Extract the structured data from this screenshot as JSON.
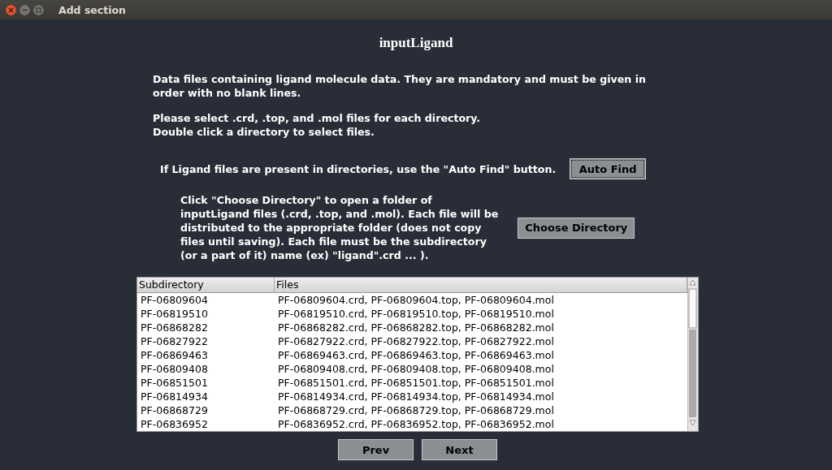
{
  "window": {
    "title": "Add section"
  },
  "heading": "inputLigand",
  "intro": [
    "Data files containing ligand molecule data. They are mandatory and must be given in\norder with no blank lines.",
    "Please select .crd, .top, and .mol files for each directory.\nDouble click a directory to select files."
  ],
  "auto_find": {
    "text": "If Ligand files are present in directories, use the \"Auto Find\" button.",
    "button": "Auto Find"
  },
  "choose_directory": {
    "text": "Click \"Choose Directory\" to open a folder of\ninputLigand files (.crd, .top, and .mol). Each file will be\ndistributed to the appropriate folder (does not copy\nfiles until saving). Each file must be the subdirectory\n(or a part of it) name (ex) \"ligand\".crd ... ).",
    "button": "Choose Directory"
  },
  "table": {
    "columns": [
      "Subdirectory",
      "Files"
    ],
    "rows": [
      [
        "PF-06809604",
        "PF-06809604.crd, PF-06809604.top, PF-06809604.mol"
      ],
      [
        "PF-06819510",
        "PF-06819510.crd, PF-06819510.top, PF-06819510.mol"
      ],
      [
        "PF-06868282",
        "PF-06868282.crd, PF-06868282.top, PF-06868282.mol"
      ],
      [
        "PF-06827922",
        "PF-06827922.crd, PF-06827922.top, PF-06827922.mol"
      ],
      [
        "PF-06869463",
        "PF-06869463.crd, PF-06869463.top, PF-06869463.mol"
      ],
      [
        "PF-06809408",
        "PF-06809408.crd, PF-06809408.top, PF-06809408.mol"
      ],
      [
        "PF-06851501",
        "PF-06851501.crd, PF-06851501.top, PF-06851501.mol"
      ],
      [
        "PF-06814934",
        "PF-06814934.crd, PF-06814934.top, PF-06814934.mol"
      ],
      [
        "PF-06868729",
        "PF-06868729.crd, PF-06868729.top, PF-06868729.mol"
      ],
      [
        "PF-06836952",
        "PF-06836952.crd, PF-06836952.top, PF-06836952.mol"
      ]
    ]
  },
  "buttons": [
    "Prev",
    "Next"
  ]
}
